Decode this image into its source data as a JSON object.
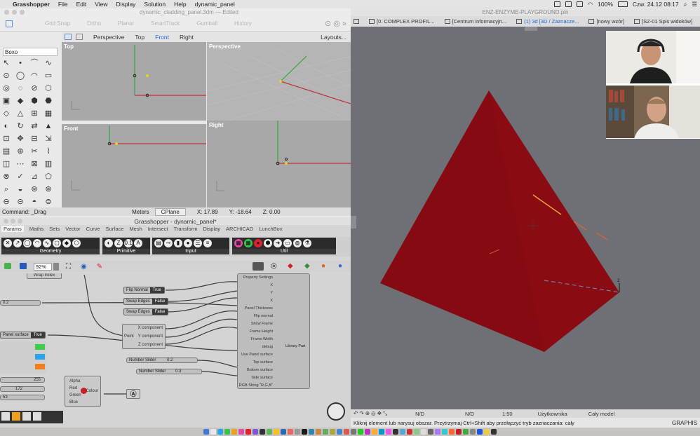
{
  "menubar": {
    "apple": "",
    "app": "Grasshopper",
    "items": [
      "File",
      "Edit",
      "View",
      "Display",
      "Solution",
      "Help",
      "dynamic_panel"
    ],
    "battery": "100%",
    "clock": "Czw. 24.12  08:17"
  },
  "rhino": {
    "title": "dynamic_cladding_panel.3dm — Edited",
    "toolbar": [
      "Grid Snap",
      "Ortho",
      "Planar",
      "SmartTrack",
      "Gumball",
      "History"
    ],
    "view_tabs": [
      "Perspective",
      "Top",
      "Front",
      "Right"
    ],
    "active_view": "Front",
    "layouts": "Layouts...",
    "command_input": "Boxo",
    "viewports": [
      "Top",
      "Perspective",
      "Front",
      "Right"
    ],
    "status": {
      "command": "Command: _Drag",
      "units": "Meters",
      "cplane": "CPlane",
      "x": "X: 17.89",
      "y": "Y: -18.64",
      "z": "Z: 0.00"
    }
  },
  "grasshopper": {
    "title": "Grasshopper - dynamic_panel*",
    "tabs": [
      "Params",
      "Maths",
      "Sets",
      "Vector",
      "Curve",
      "Surface",
      "Mesh",
      "Intersect",
      "Transform",
      "Display",
      "ARCHICAD",
      "LunchBox"
    ],
    "active_tab": "Params",
    "ribbon_groups": [
      "Geometry",
      "Primitive",
      "Input",
      "Util"
    ],
    "zoom": "92%",
    "canvas": {
      "wrap": "Wrap",
      "index": "Index",
      "slider_02": "0.2",
      "toggles": [
        {
          "name": "Flip Normal",
          "value": "True"
        },
        {
          "name": "Swap Edges",
          "value": "False"
        },
        {
          "name": "Swap Edges",
          "value": "False"
        }
      ],
      "panel_surface": {
        "name": "Panel surface",
        "value": "True"
      },
      "point_comp": {
        "in": "Point",
        "outs": [
          "X component",
          "Y component",
          "Z component"
        ]
      },
      "number_sliders": [
        {
          "name": "Number Slider",
          "value": "0.2"
        },
        {
          "name": "Number Slider",
          "value": "0.3"
        }
      ],
      "big_component_inputs": [
        "Property Settings",
        "X",
        "Y",
        "X",
        "Panel Thickness",
        "Flip normal",
        "Show Frame",
        "Frame Height",
        "Frame Width",
        "debug",
        "Use Panel surface",
        "Top surface",
        "Bottom surface",
        "Side surface",
        "RGB String \"R,G,B\""
      ],
      "big_component_output": "Library Part",
      "colour": {
        "ins": [
          "Alpha",
          "Red",
          "Green",
          "Blue"
        ],
        "out": "Colour"
      },
      "color_values": [
        "255",
        "172",
        "53"
      ]
    }
  },
  "archicad": {
    "title": "ENZ-ENZYME-PLAYGROUND.pln",
    "tabs": [
      {
        "label": "[0. COMPLEX PROFIL..."
      },
      {
        "label": "[Centrum informacyjn..."
      },
      {
        "label": "(1) 3d [3D / Zaznacze..."
      },
      {
        "label": "[nowy wzór]"
      },
      {
        "label": "[SZ-01 Spis widoków]"
      }
    ],
    "active_tab": 2,
    "bottom_bar": [
      "N/D",
      "N/D",
      "1:50",
      "Użytkownika",
      "Cały model"
    ],
    "status_message": "Kliknij element lub narysuj obszar. Przytrzymaj Ctrl+Shift aby przełączyć tryb zaznaczania: cały",
    "status_right": "GRAPHIS",
    "shape_color": "#8b0b12",
    "vertex_label": "2"
  }
}
